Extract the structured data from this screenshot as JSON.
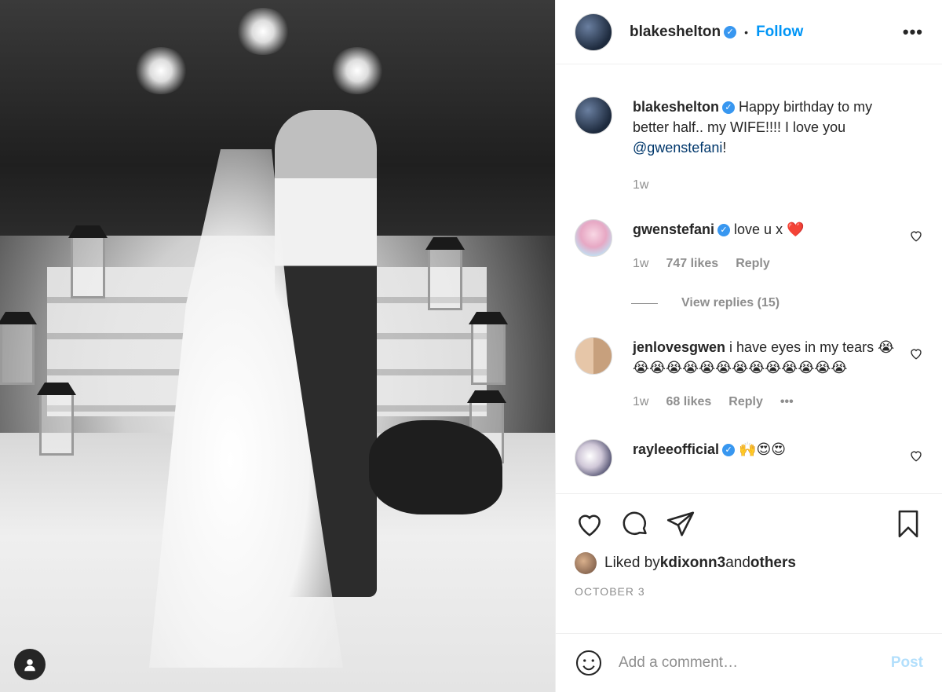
{
  "post": {
    "author": "blakeshelton",
    "follow_label": "Follow",
    "separator": "•",
    "more_icon": "more-horizontal-icon"
  },
  "caption": {
    "username": "blakeshelton",
    "text_pre": " Happy birthday to my better half.. my WIFE!!!! I love you ",
    "mention": "@gwenstefani",
    "text_post": "!",
    "time": "1w"
  },
  "comments": [
    {
      "username": "gwenstefani",
      "verified": true,
      "text": " love u x ❤️",
      "time": "1w",
      "likes": "747 likes",
      "reply": "Reply",
      "view_replies": "View replies (15)"
    },
    {
      "username": "jenlovesgwen",
      "verified": false,
      "text": " i have eyes in my tears 😭😭😭😭😭😭😭😭😭😭😭😭😭😭",
      "time": "1w",
      "likes": "68 likes",
      "reply": "Reply",
      "more": "•••"
    },
    {
      "username": "rayleeofficial",
      "verified": true,
      "text": " 🙌😍😍"
    }
  ],
  "likes": {
    "prefix": "Liked by ",
    "user": "kdixonn3",
    "middle": " and ",
    "others": "others"
  },
  "date": "OCTOBER 3",
  "add_comment": {
    "placeholder": "Add a comment…",
    "post_label": "Post"
  },
  "colors": {
    "accent": "#0095f6",
    "verified": "#3897f0",
    "muted": "#8e8e8e"
  }
}
